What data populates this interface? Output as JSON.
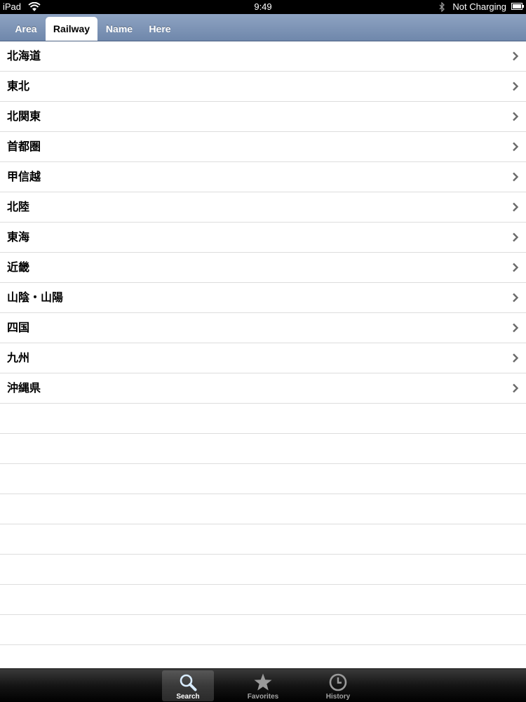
{
  "status_bar": {
    "device": "iPad",
    "time": "9:49",
    "charging": "Not Charging"
  },
  "tabs": [
    {
      "label": "Area",
      "active": false
    },
    {
      "label": "Railway",
      "active": true
    },
    {
      "label": "Name",
      "active": false
    },
    {
      "label": "Here",
      "active": false
    }
  ],
  "regions": [
    "北海道",
    "東北",
    "北関東",
    "首都圏",
    "甲信越",
    "北陸",
    "東海",
    "近畿",
    "山陰・山陽",
    "四国",
    "九州",
    "沖縄県"
  ],
  "tab_bar": {
    "items": [
      {
        "label": "Search",
        "icon": "search-icon",
        "selected": true
      },
      {
        "label": "Favorites",
        "icon": "star-icon",
        "selected": false
      },
      {
        "label": "History",
        "icon": "clock-icon",
        "selected": false
      }
    ]
  },
  "colors": {
    "header_blue": "#7a90b3",
    "selected_tab_bg": "#ffffff",
    "tab_bar_bg": "#1a1a1a",
    "divider": "#dddddd"
  }
}
